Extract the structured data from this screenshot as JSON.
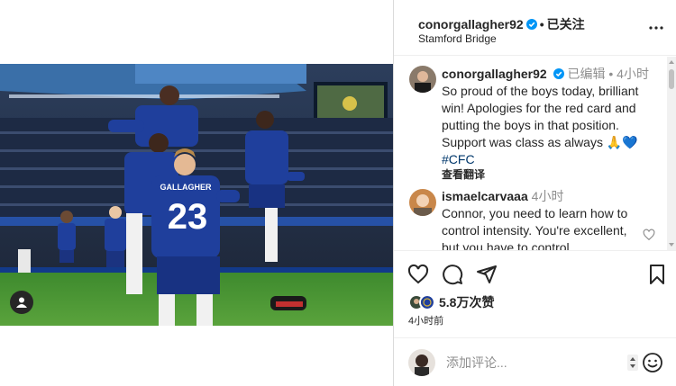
{
  "post": {
    "username": "conorgallagher92",
    "follow_status": "已关注",
    "location": "Stamford Bridge",
    "photo_jersey_name": "GALLAGHER",
    "photo_jersey_number": "23"
  },
  "caption": {
    "username": "conorgallagher92",
    "edited": "已编辑",
    "time": "4小时",
    "text": "So proud of the boys today, brilliant win! Apologies for the red card and putting the boys in that position. Support was class as always",
    "emoji": "🙏💙",
    "hashtag": "#CFC",
    "translate": "查看翻译"
  },
  "comments": [
    {
      "username": "ismaelcarvaaa",
      "time": "4小时",
      "text": "Connor, you need to learn how to control intensity. You're excellent, but you have to control"
    }
  ],
  "actions": {
    "likes": "5.8万次赞",
    "posted_time": "4小时前"
  },
  "add_comment": {
    "placeholder": "添加评论..."
  },
  "icons": [
    "verified-badge-icon",
    "more-icon",
    "heart-icon",
    "comment-icon",
    "share-icon",
    "bookmark-icon",
    "emoji-icon",
    "user-tag-icon"
  ],
  "colors": {
    "accent_blue": "#0095f6",
    "hashtag": "#00376b",
    "chelsea_blue": "#1f3f9c"
  }
}
